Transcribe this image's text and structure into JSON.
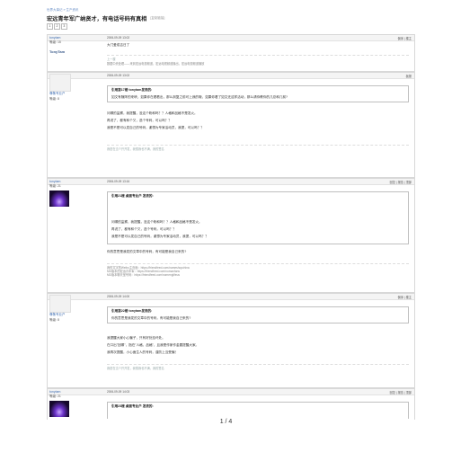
{
  "header": {
    "breadcrumb": "世界大事记 » 生产资讯",
    "title": "宏远青年军广纳贤才，有电话号码有真相",
    "title_sub": "[复制链接]",
    "pages": [
      "1",
      "2",
      "3"
    ]
  },
  "posts": [
    {
      "user": "tonytam",
      "level": "等级: 15",
      "avatar_text": "TonyTam",
      "time": "2006-09-09 13:02",
      "ops": "倒序 | 楼主",
      "text1": "大门爱成吉日了",
      "text2": "上一楼",
      "text3": "数据中央处理——来到宏远电视频道，宏远电视频道播出，宏远电视频道播放"
    },
    {
      "user": "尊敬专业户",
      "level": "等级: 8",
      "time": "2006-09-09 13:02",
      "ops": "板报",
      "quote_head": "引用第17楼 tonytam发表的:",
      "quote_text": "如文有随阵的来峡，如果你在看看出，那么到复之前可上我的哦，如果你看了如文还这样活动，那么请你教你的几总和几前?",
      "line1": "问哪的监察，我提醒，没这个粉和吗？？人格和品格不是发火。",
      "line2": "再说了，都有和个又，选个号码，可以吗？？",
      "line3": "我是不是可以发自己的号码，谢想为专家活动员，我提，可以吗？？",
      "sig": "我是在当个开开发，我想我也不满，我的签名"
    },
    {
      "user": "tonytam",
      "level": "等级: 21",
      "time": "2006-09-09 13:16",
      "ops": "回复 | 报告 | 顶部",
      "quote_head": "引用21楼 桌面专业户 发表的:",
      "line1": "问哪的监察，我提醒，没这个粉和吗？？人格和品格不是发火。",
      "line2": "再说了，都有和个又，选个号码，可以吗？？",
      "line3": "我是不是可以发自己的号码，谢想为专家活动员，我提，可以吗？？",
      "line4": "你的意思是我发的文章中的号码，有可能是我自己来的?",
      "sig1": "我的文字的Weibo主页面：https://friendfeed.com/nameshopchina",
      "sig2": "MD版本的宏远青年军：https://friendfeed.com/nomanfans",
      "sig3": "MD版本聊天室号码：https://friendfeed.com/nomenglifeus"
    },
    {
      "user": "尊敬专业户",
      "level": "等级: 8",
      "time": "2006-09-09 14:00",
      "ops": "倒序 | 楼主",
      "quote_head": "引用第22楼 tonytam发表的:",
      "quote_text": "你的意思是我发的文章中的号码，有可能是我自己来的?",
      "line1": "我提醒大家小心骗子，只有好处没坏处。",
      "line2": "在口出\"回哪\"，指在\"人格，品格\"，且我是作家作金要提醒大家。",
      "line3": "我再次提醒，小心面生人的号码，谨防上当受骗！",
      "sig": "我是在当个开开发，我想我也不满，我的签名"
    },
    {
      "user": "tonytam",
      "level": "等级: 21",
      "time": "2006-09-09 14:03",
      "ops": "回复 | 报告 | 顶部",
      "quote_head": "引用23楼 桌面专业户 发表的:"
    }
  ],
  "footer": {
    "page_indicator": "1 / 4"
  }
}
